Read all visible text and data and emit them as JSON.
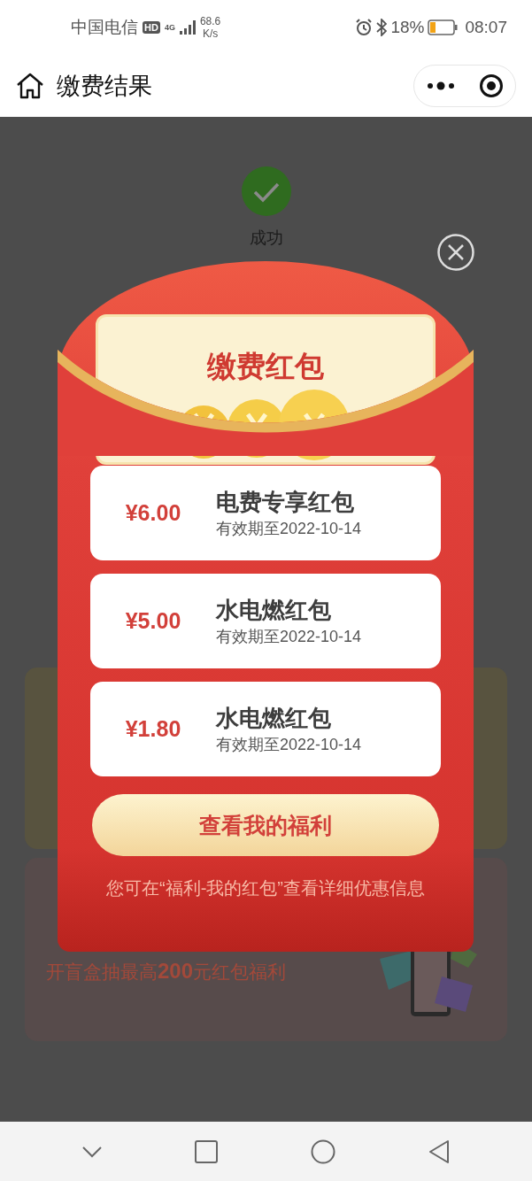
{
  "status_bar": {
    "carrier": "中国电信",
    "hd_badge": "HD",
    "network": "4G",
    "speed_value": "68.6",
    "speed_unit": "K/s",
    "battery": "18%",
    "time": "08:07"
  },
  "nav_bar": {
    "title": "缴费结果"
  },
  "result": {
    "status": "成功"
  },
  "promo_banner": {
    "text": "开盲盒抽最高**200**元红包福利"
  },
  "red_packet_modal": {
    "title": "缴费红包",
    "coupons": [
      {
        "amount": "¥6.00",
        "name": "电费专享红包",
        "expiry": "有效期至2022-10-14"
      },
      {
        "amount": "¥5.00",
        "name": "水电燃红包",
        "expiry": "有效期至2022-10-14"
      },
      {
        "amount": "¥1.80",
        "name": "水电燃红包",
        "expiry": "有效期至2022-10-14"
      }
    ],
    "button": "查看我的福利",
    "note": "您可在“福利-我的红包”查看详细优惠信息"
  }
}
